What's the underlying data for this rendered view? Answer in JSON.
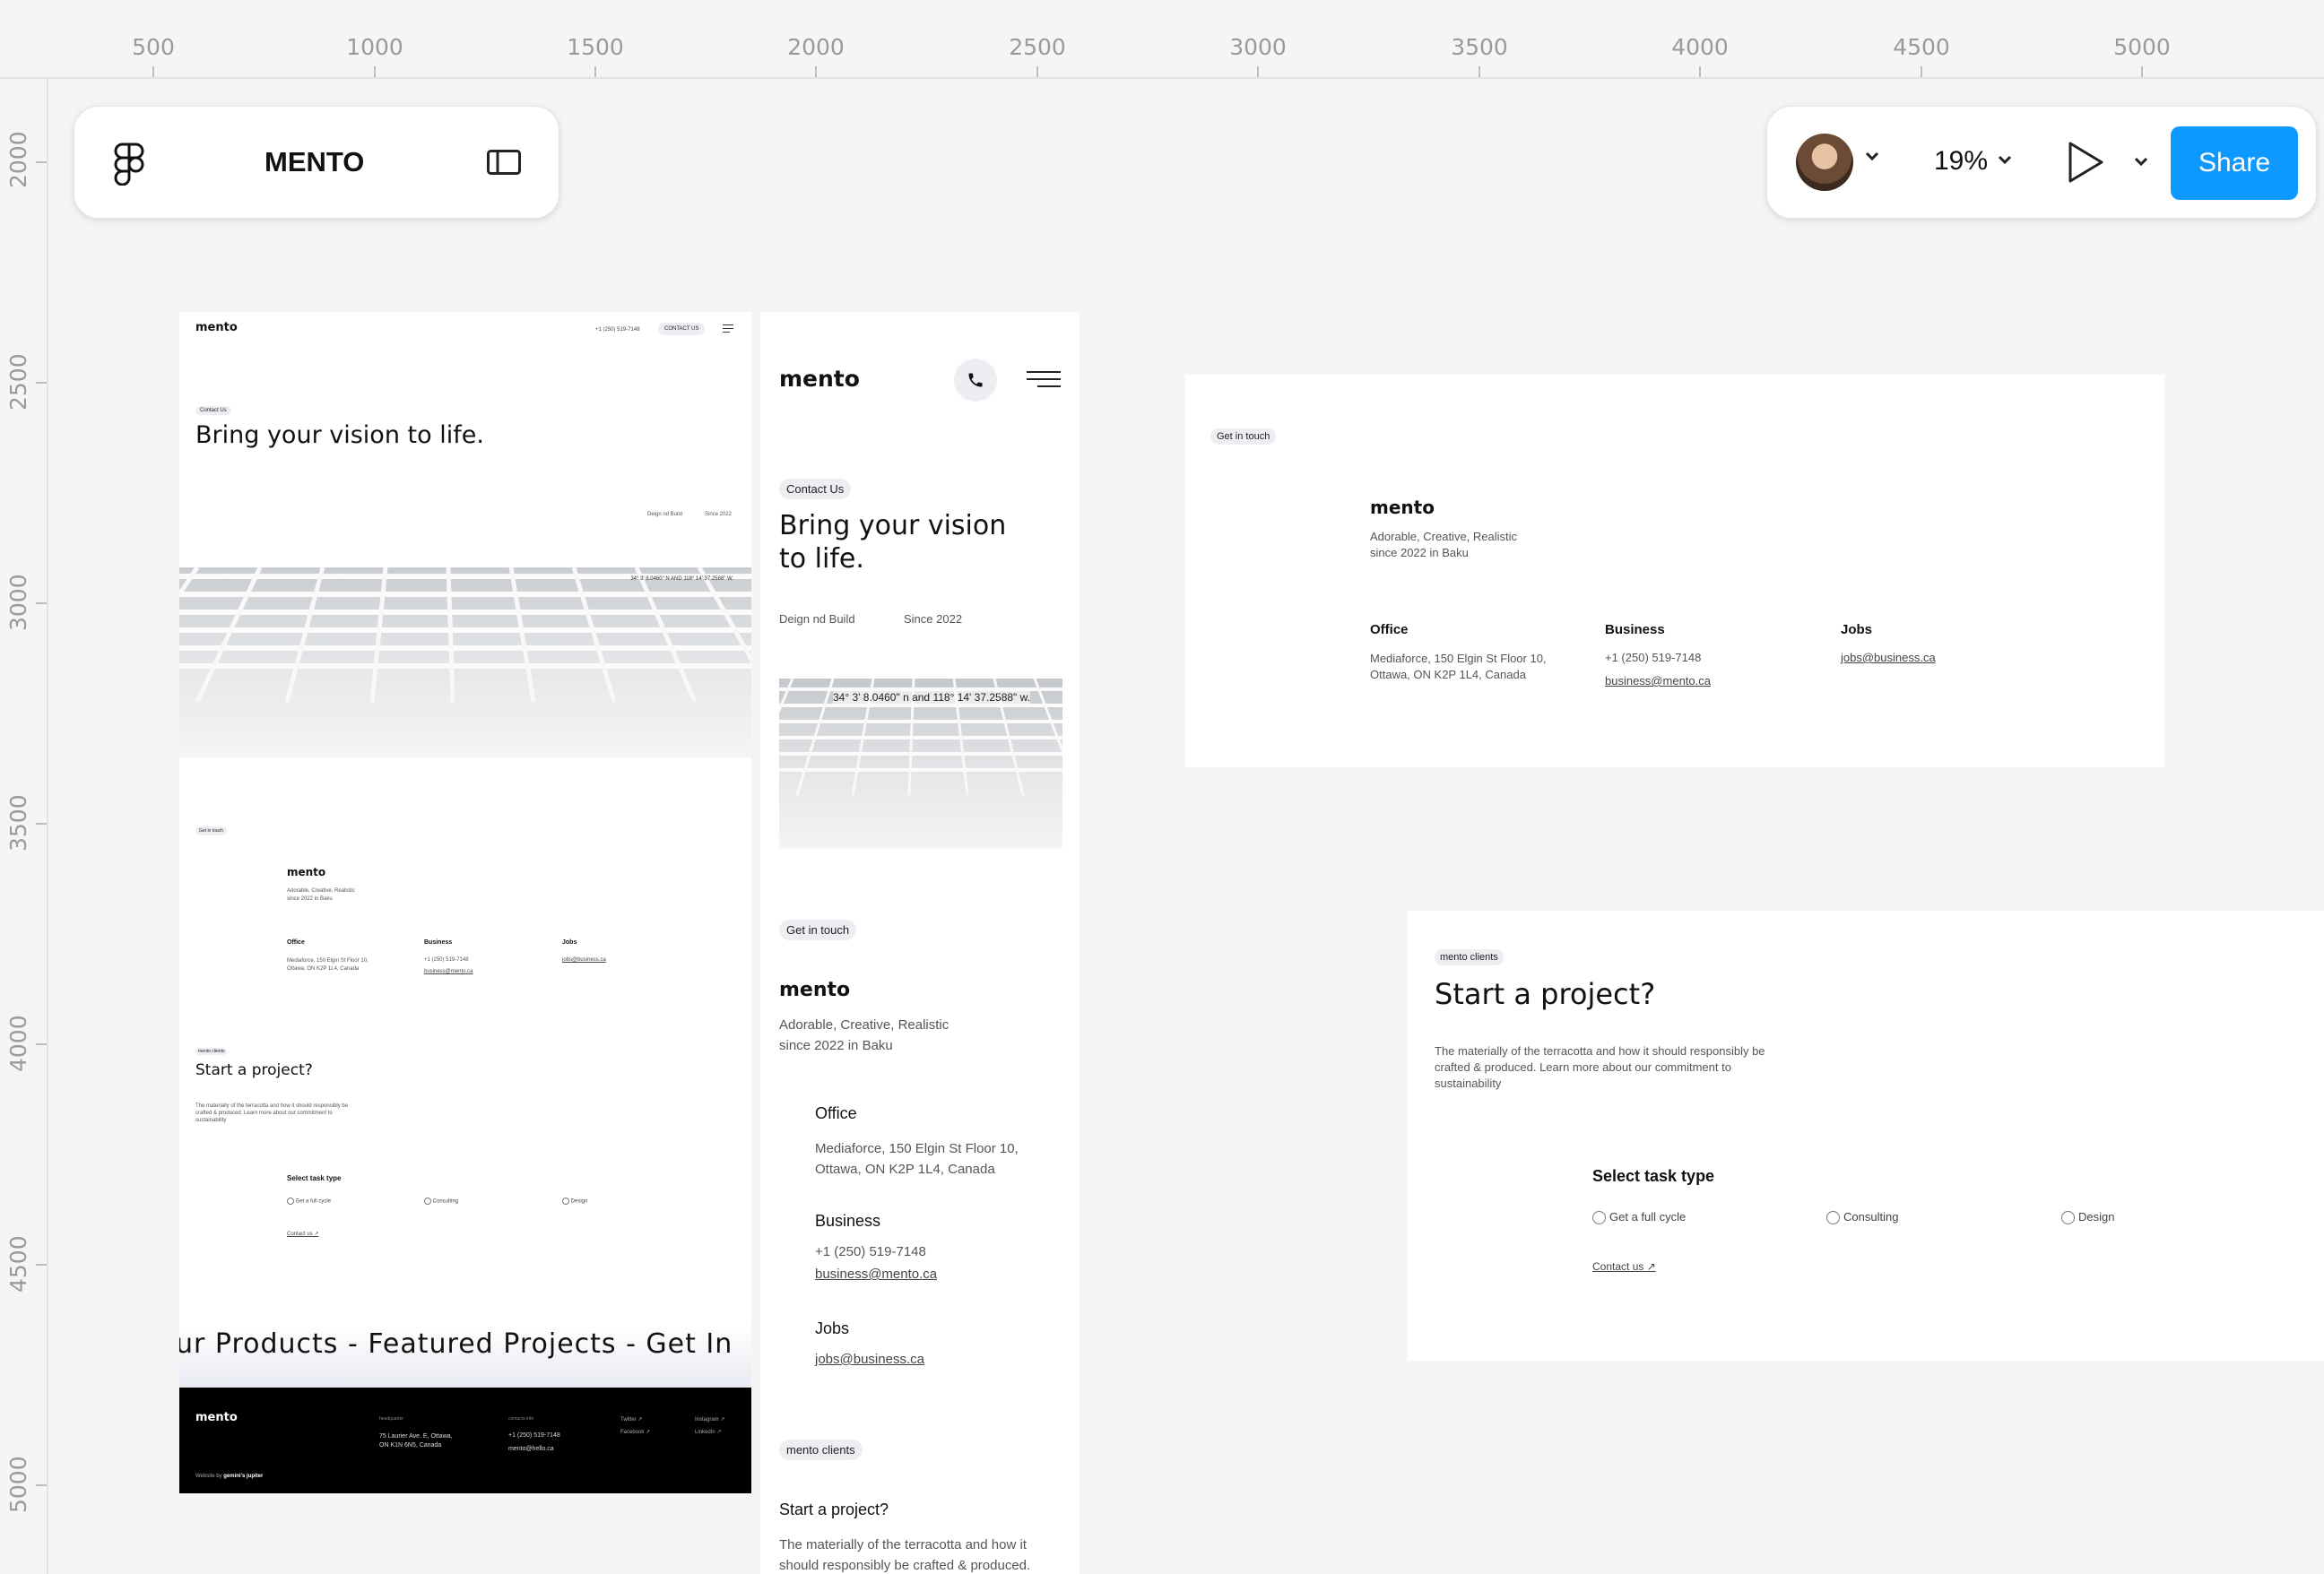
{
  "ruler": {
    "top_labels": [
      "500",
      "1000",
      "1500",
      "2000",
      "2500",
      "3000",
      "3500",
      "4000",
      "4500",
      "5000"
    ],
    "left_labels": [
      "2000",
      "2500",
      "3000",
      "3500",
      "4000",
      "4500",
      "5000"
    ]
  },
  "toolbar": {
    "file_name": "MENTO",
    "zoom": "19%",
    "share_label": "Share"
  },
  "desktop": {
    "logo": "mento",
    "phone": "+1 (250) 519-7148",
    "contact_btn": "CONTACT US",
    "contact_pill": "Contact Us",
    "hero": "Bring your vision to life.",
    "meta1": "Deign nd Build",
    "meta2": "Since 2022",
    "coords": "34° 3' 8.0460\" N AND 118° 14' 37.2588\" W.",
    "get_in_touch": "Get in touch",
    "info_logo": "mento",
    "tagline1": "Adorable, Creative, Realistic",
    "tagline2": "since 2022 in Baku",
    "office_h": "Office",
    "office_1": "Mediaforce, 150 Elgin St Floor 10,",
    "office_2": "Ottawa, ON K2P 1L4, Canada",
    "business_h": "Business",
    "business_phone": "+1 (250) 519-7148",
    "business_mail": "business@mento.ca",
    "jobs_h": "Jobs",
    "jobs_mail": "jobs@business.ca",
    "clients_pill": "mento clients",
    "project_h": "Start a project?",
    "project_p1": "The materially of the terracotta and how it should responsibly be",
    "project_p2": "crafted & produced. Learn more about our commitment to",
    "project_p3": "sustainability",
    "select_task": "Select task type",
    "opt1": "Get a full cycle",
    "opt2": "Consulting",
    "opt3": "Design",
    "contact_link": "Contact us ↗",
    "marquee": "ur Products - Featured Projects - Get In",
    "footer_logo": "mento",
    "footer_hq_label": "headquarter",
    "footer_hq_1": "75 Laurier Ave. E, Ottawa,",
    "footer_hq_2": "ON K1N 6N5, Canada",
    "footer_contact_label": "contacts info",
    "footer_phone": "+1 (250) 519-7148",
    "footer_mail": "mento@hello.ca",
    "footer_twitter": "Twitter ↗",
    "footer_facebook": "Facebook ↗",
    "footer_instagram": "Instagram ↗",
    "footer_linkedin": "LinkedIn ↗",
    "footer_credit_pre": "Website by",
    "footer_credit": "gemini's jupiter"
  },
  "mobile": {
    "logo": "mento",
    "contact_pill": "Contact Us",
    "hero1": "Bring your vision",
    "hero2": "to life.",
    "meta1": "Deign nd Build",
    "meta2": "Since 2022",
    "coords": "34° 3' 8.0460\" n and 118° 14' 37.2588\" w.",
    "get_in_touch": "Get in touch",
    "info_logo": "mento",
    "tagline1": "Adorable, Creative, Realistic",
    "tagline2": "since 2022 in Baku",
    "office_h": "Office",
    "office_1": "Mediaforce, 150 Elgin St Floor 10,",
    "office_2": "Ottawa, ON K2P 1L4, Canada",
    "business_h": "Business",
    "business_phone": "+1 (250) 519-7148",
    "business_mail": "business@mento.ca",
    "jobs_h": "Jobs",
    "jobs_mail": "jobs@business.ca",
    "clients_pill": "mento clients",
    "project_h": "Start a project?",
    "project_p1": "The materially of the terracotta and how it",
    "project_p2": "should responsibly be crafted & produced."
  },
  "touch_frame": {
    "pill": "Get in touch",
    "logo": "mento",
    "tagline1": "Adorable, Creative, Realistic",
    "tagline2": "since 2022 in Baku",
    "office_h": "Office",
    "office_1": "Mediaforce, 150 Elgin St Floor 10,",
    "office_2": "Ottawa, ON K2P 1L4, Canada",
    "business_h": "Business",
    "business_phone": "+1 (250) 519-7148",
    "business_mail": "business@mento.ca",
    "jobs_h": "Jobs",
    "jobs_mail": "jobs@business.ca"
  },
  "project_frame": {
    "pill": "mento clients",
    "title": "Start a project?",
    "p1": "The materially of the terracotta and how it should responsibly be",
    "p2": "crafted & produced. Learn more about our commitment to",
    "p3": "sustainability",
    "select_task": "Select task type",
    "opt1": "Get a full cycle",
    "opt2": "Consulting",
    "opt3": "Design",
    "contact_link": "Contact us ↗"
  }
}
